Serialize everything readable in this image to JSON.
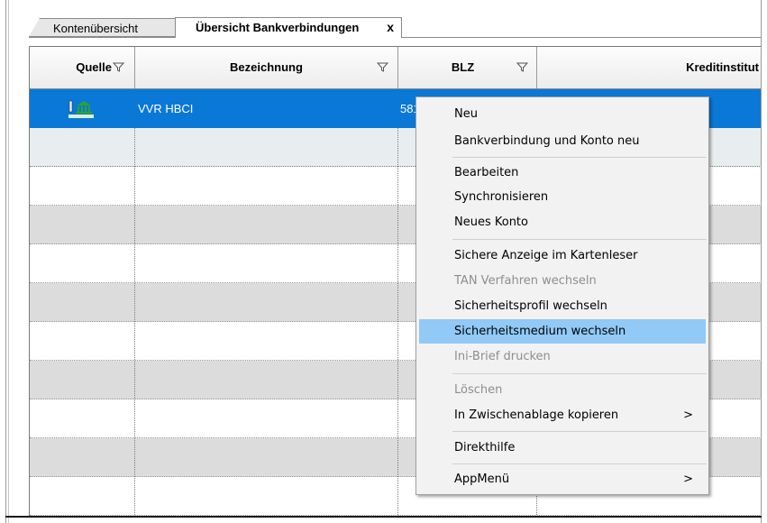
{
  "tabs": [
    {
      "label": "Kontenübersicht",
      "active": false
    },
    {
      "label": "Übersicht Bankverbindungen",
      "active": true,
      "close": "x"
    }
  ],
  "grid": {
    "columns": [
      "Quelle",
      "Bezeichnung",
      "BLZ",
      "Kreditinstitut"
    ],
    "rows": [
      {
        "icon": "bank-hbci-icon",
        "bezeichnung": "VVR HBCI",
        "blz": "581",
        "kreditinstitut": "",
        "selected": true
      }
    ]
  },
  "context_menu": {
    "items": [
      {
        "label": "Neu",
        "enabled": true
      },
      {
        "label": "Bankverbindung und Konto neu",
        "enabled": true
      },
      {
        "label": "Bearbeiten",
        "enabled": true
      },
      {
        "label": "Synchronisieren",
        "enabled": true
      },
      {
        "label": "Neues Konto",
        "enabled": true
      },
      {
        "label": "Sichere Anzeige im Kartenleser",
        "enabled": true
      },
      {
        "label": "TAN Verfahren wechseln",
        "enabled": false
      },
      {
        "label": "Sicherheitsprofil wechseln",
        "enabled": true
      },
      {
        "label": "Sicherheitsmedium wechseln",
        "enabled": true,
        "highlighted": true
      },
      {
        "label": "Ini-Brief drucken",
        "enabled": false
      },
      {
        "label": "Löschen",
        "enabled": false
      },
      {
        "label": "In Zwischenablage kopieren",
        "enabled": true,
        "submenu": ">"
      },
      {
        "label": "Direkthilfe",
        "enabled": true
      },
      {
        "label": "AppMenü",
        "enabled": true,
        "submenu": ">"
      }
    ]
  },
  "colors": {
    "selection": "#0a78d7",
    "menu_highlight": "#91c9f7",
    "disabled_text": "#8e8e8e"
  }
}
